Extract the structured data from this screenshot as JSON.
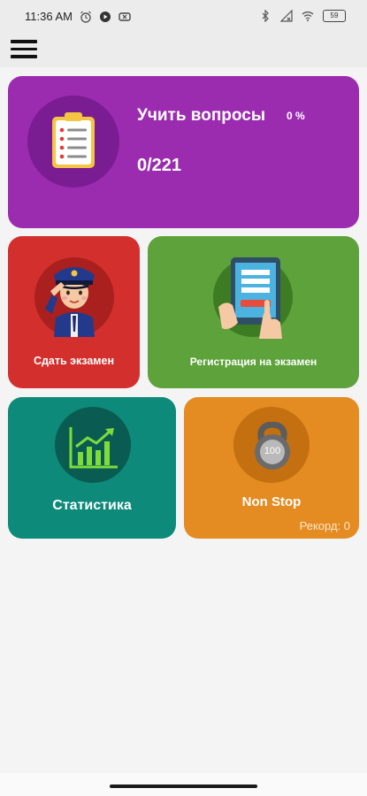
{
  "status_bar": {
    "time": "11:36 AM",
    "battery": "59"
  },
  "app_bar": {
    "menu_icon": "hamburger-menu-icon"
  },
  "learn_card": {
    "title": "Учить вопросы",
    "percent": "0 %",
    "progress": "0/221",
    "icon": "clipboard-checklist-icon",
    "color": "#9b2cb0"
  },
  "exam_card": {
    "label": "Сдать экзамен",
    "icon": "police-officer-icon",
    "color": "#d22f2d"
  },
  "registration_card": {
    "label": "Регистрация на экзамен",
    "icon": "tablet-form-icon",
    "color": "#5da23a"
  },
  "stats_card": {
    "label": "Статистика",
    "icon": "growth-chart-icon",
    "color": "#0d8a7a"
  },
  "nonstop_card": {
    "label": "Non Stop",
    "record": "Рекорд: 0",
    "weight_label": "100",
    "icon": "kettlebell-icon",
    "color": "#e48b21"
  }
}
